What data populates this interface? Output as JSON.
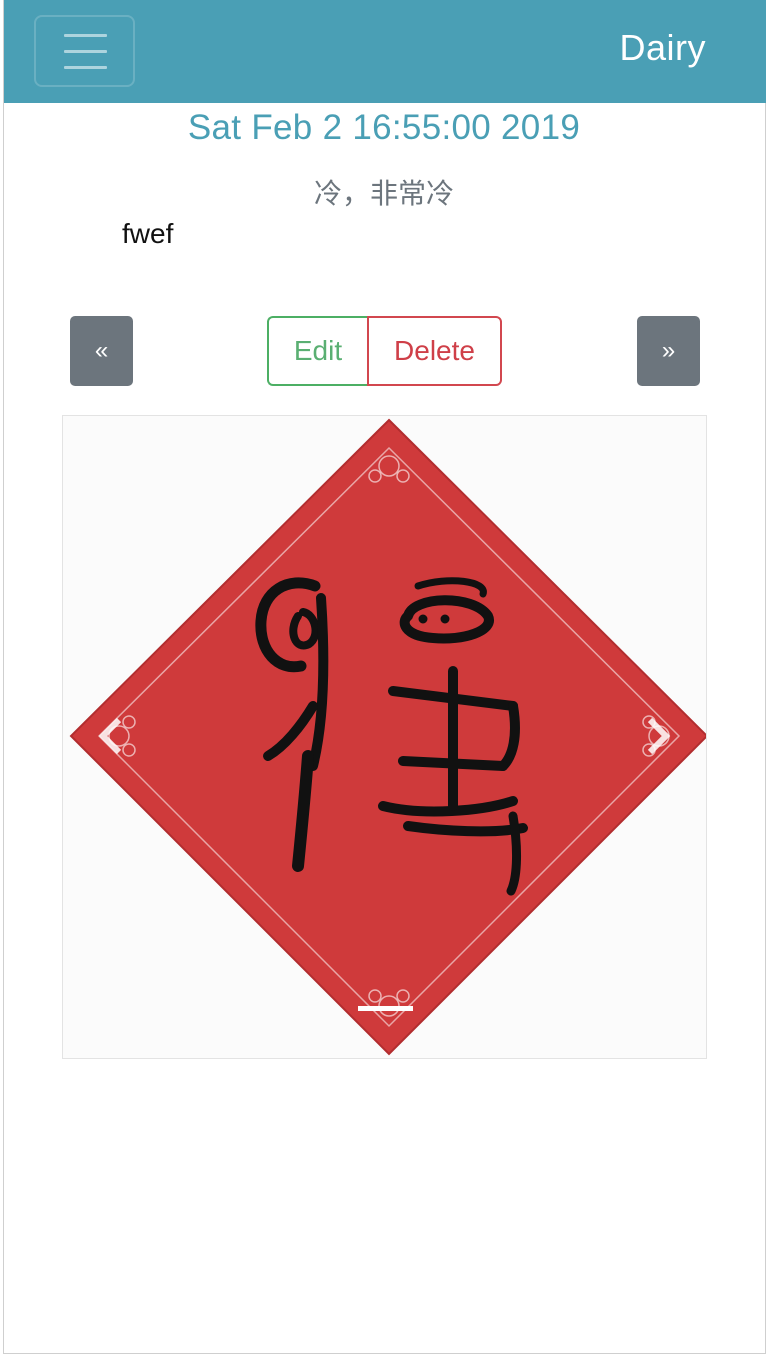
{
  "navbar": {
    "brand": "Dairy",
    "menu_icon": "hamburger-menu-icon",
    "color": "#4a9fb5"
  },
  "entry": {
    "date": "Sat Feb 2 16:55:00 2019",
    "weather": "冷，非常冷",
    "body": "fwef"
  },
  "actions": {
    "prev_label": "«",
    "next_label": "»",
    "edit_label": "Edit",
    "delete_label": "Delete"
  },
  "carousel": {
    "image_icon": "fu-character-red-diamond-image",
    "prev_icon": "chevron-left-icon",
    "next_icon": "chevron-right-icon",
    "indicator_count": 1
  },
  "colors": {
    "accent": "#4a9fb5",
    "secondary": "#6c757d",
    "success": "#4caf64",
    "danger": "#d2474f"
  }
}
